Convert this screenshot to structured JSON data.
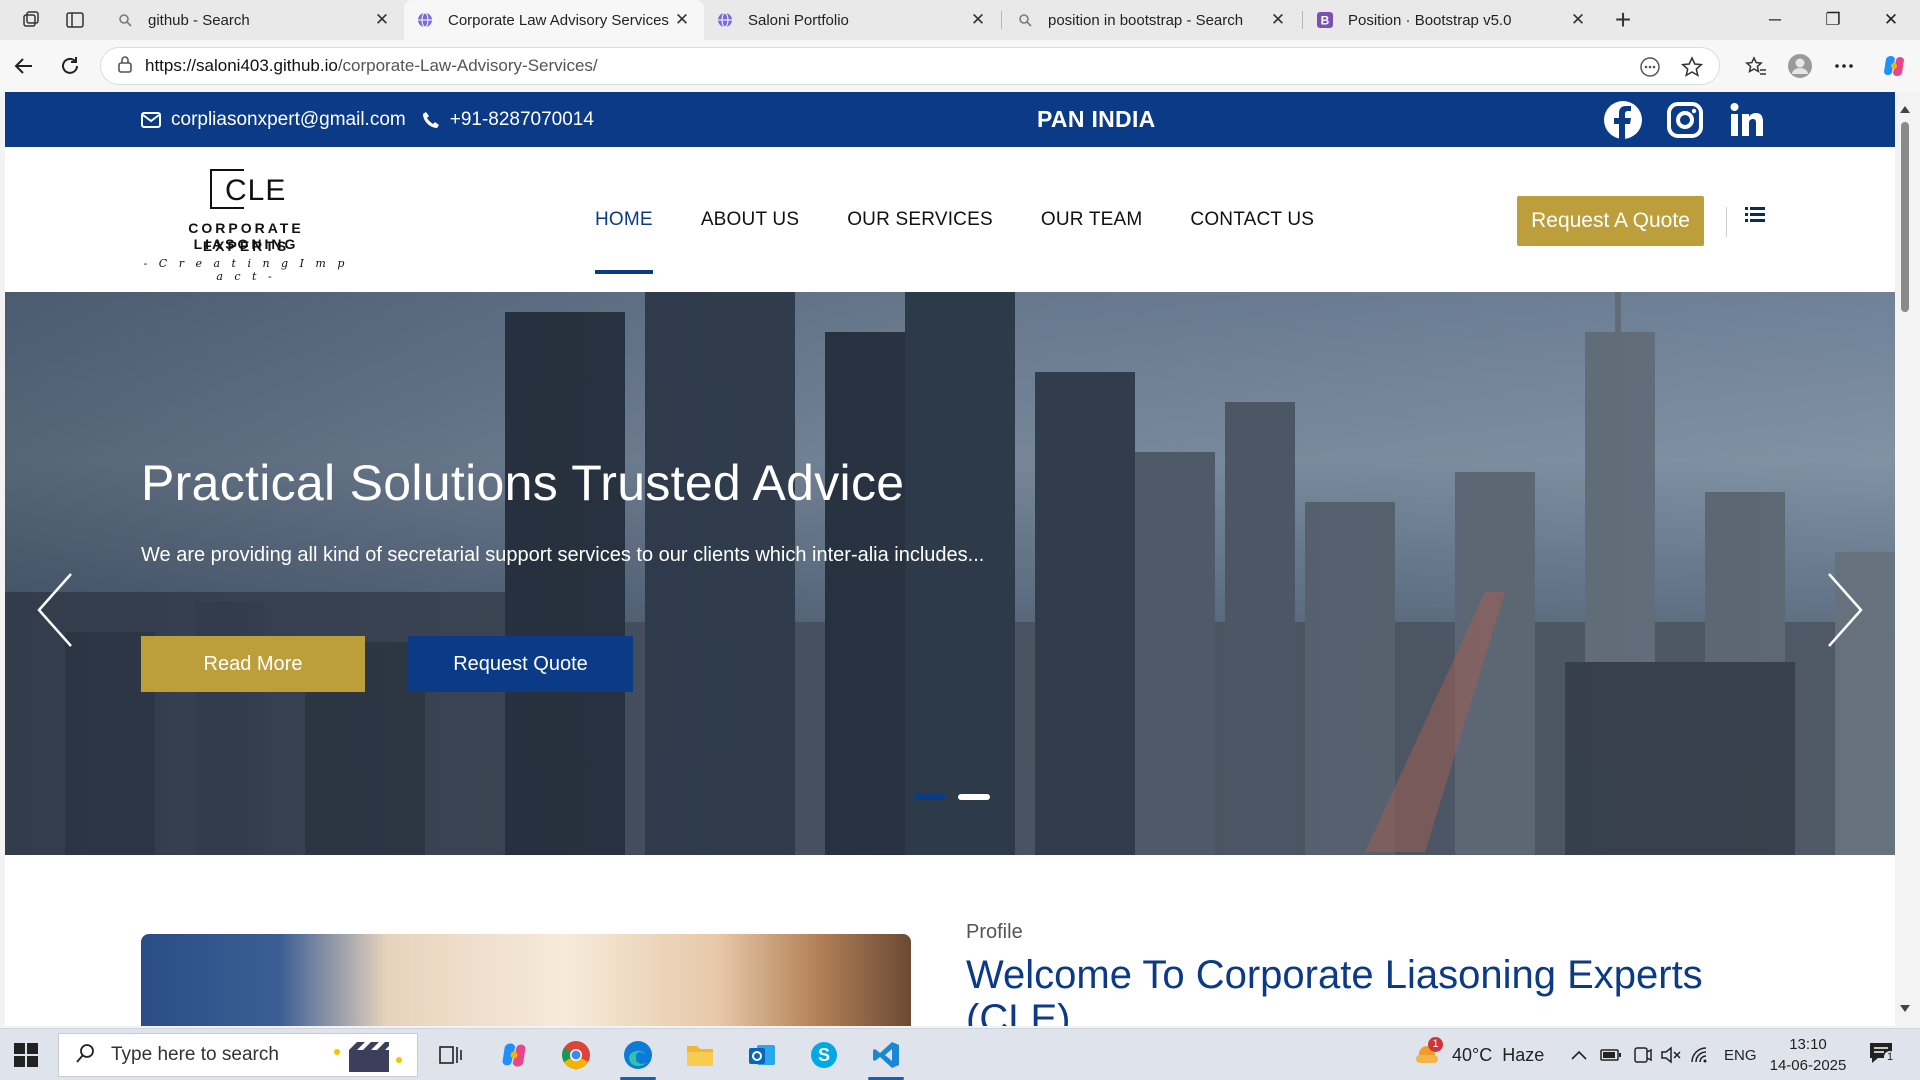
{
  "browser": {
    "tabs": [
      {
        "title": "github - Search",
        "icon": "search-icon",
        "active": false
      },
      {
        "title": "Corporate Law Advisory Services |",
        "icon": "globe-icon",
        "active": true
      },
      {
        "title": "Saloni Portfolio",
        "icon": "globe-icon",
        "active": false
      },
      {
        "title": "position in bootstrap - Search",
        "icon": "search-icon",
        "active": false
      },
      {
        "title": "Position · Bootstrap v5.0",
        "icon": "bootstrap-icon",
        "active": false
      }
    ],
    "url_domain": "https://saloni403.github.io",
    "url_path": "/corporate-Law-Advisory-Services/"
  },
  "site": {
    "topbar": {
      "email": "corpliasonxpert@gmail.com",
      "phone": "+91-8287070014",
      "center_text": "PAN INDIA",
      "social": [
        "facebook-icon",
        "instagram-icon",
        "linkedin-icon"
      ]
    },
    "logo": {
      "letters": "CLE",
      "line1": "CORPORATE LIASONING",
      "line2": "EXPERTS",
      "tagline": "- C r e a t i n g   I m p a c t -"
    },
    "nav": {
      "items": [
        "HOME",
        "ABOUT US",
        "OUR SERVICES",
        "OUR TEAM",
        "CONTACT US"
      ],
      "active": "HOME",
      "quote_button": "Request A Quote"
    },
    "hero": {
      "title": "Practical Solutions Trusted Advice",
      "subtitle": "We are providing all kind of secretarial support services to our clients which inter-alia includes...",
      "btn_primary": "Read More",
      "btn_secondary": "Request Quote",
      "slide_count": 2,
      "active_slide": 1
    },
    "about": {
      "kicker": "Profile",
      "heading": "Welcome To Corporate Liasoning Experts (CLE)"
    }
  },
  "taskbar": {
    "search_placeholder": "Type here to search",
    "weather": "40°C  Haze",
    "weather_badge": "1",
    "language": "ENG",
    "time": "13:10",
    "date": "14-06-2025",
    "notification_count": "1"
  },
  "colors": {
    "brand_blue": "#0b3a86",
    "brand_gold": "#bc9f3a"
  }
}
